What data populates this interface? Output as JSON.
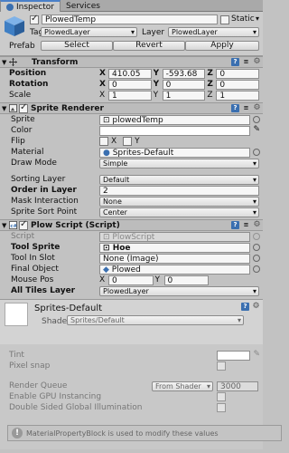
{
  "tabs": [
    {
      "label": "Inspector"
    },
    {
      "label": "Services"
    }
  ],
  "object": {
    "name": "PlowedTemp",
    "static_label": "Static",
    "tag_label": "Tag",
    "tag_value": "PlowedLayer",
    "layer_label": "Layer",
    "layer_value": "PlowedLayer",
    "prefab_label": "Prefab",
    "select": "Select",
    "revert": "Revert",
    "apply": "Apply"
  },
  "transform": {
    "title": "Transform",
    "rows": [
      {
        "label": "Position",
        "x": "410.05",
        "y": "-593.68",
        "z": "0"
      },
      {
        "label": "Rotation",
        "x": "0",
        "y": "0",
        "z": "0"
      },
      {
        "label": "Scale",
        "x": "1",
        "y": "1",
        "z": "1"
      }
    ]
  },
  "sprite_renderer": {
    "title": "Sprite Renderer",
    "sprite_label": "Sprite",
    "sprite_value": "plowedTemp",
    "color_label": "Color",
    "flip_label": "Flip",
    "flip_x": "X",
    "flip_y": "Y",
    "material_label": "Material",
    "material_value": "Sprites-Default",
    "draw_mode_label": "Draw Mode",
    "draw_mode_value": "Simple",
    "sorting_layer_label": "Sorting Layer",
    "sorting_layer_value": "Default",
    "order_label": "Order in Layer",
    "order_value": "2",
    "mask_label": "Mask Interaction",
    "mask_value": "None",
    "sort_point_label": "Sprite Sort Point",
    "sort_point_value": "Center"
  },
  "plow_script": {
    "title": "Plow Script (Script)",
    "script_label": "Script",
    "script_value": "PlowScript",
    "tool_sprite_label": "Tool Sprite",
    "tool_sprite_value": "Hoe",
    "tool_slot_label": "Tool In Slot",
    "tool_slot_value": "None (Image)",
    "final_object_label": "Final Object",
    "final_object_value": "Plowed",
    "mouse_pos_label": "Mouse Pos",
    "mouse_x": "0",
    "mouse_y": "0",
    "mouse_x_axis": "X",
    "mouse_y_axis": "Y",
    "tiles_layer_label": "All Tiles Layer",
    "tiles_layer_value": "PlowedLayer"
  },
  "material": {
    "name": "Sprites-Default",
    "shader_label": "Shader",
    "shader_value": "Sprites/Default",
    "tint_label": "Tint",
    "pixel_snap_label": "Pixel snap",
    "render_queue_label": "Render Queue",
    "render_queue_mode": "From Shader",
    "render_queue_value": "3000",
    "gpu_label": "Enable GPU Instancing",
    "dsgi_label": "Double Sided Global Illumination"
  },
  "help": {
    "text": "MaterialPropertyBlock is used to modify these values"
  },
  "colors": {
    "accent": "#3a6fb0",
    "background": "#c2c2c2"
  }
}
